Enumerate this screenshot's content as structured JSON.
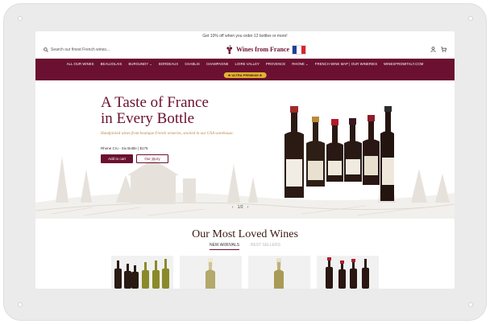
{
  "promo_bar": "Get 10% off when you order 12 bottles or more!",
  "header": {
    "search_placeholder": "Search our finest French wines...",
    "logo_text": "Wines from France"
  },
  "nav": {
    "items": [
      "ALL OUR WINES",
      "BEAUJOLAIS",
      "BURGUNDY ⌄",
      "BORDEAUX",
      "CHABLIS",
      "CHAMPAGNE",
      "LOIRE VALLEY",
      "PROVENCE",
      "RHONE ⌄",
      "FRENCH WINE MAP | OUR WINERIES",
      "WINESFROMITALY.COM"
    ],
    "badge": "★ ULTRA PREMIUM ★"
  },
  "hero": {
    "title_line1": "A Taste of France",
    "title_line2": "in Every Bottle",
    "subtitle": "Handpicked wines from boutique French wineries, stocked in our USA warehouse.",
    "note": "Rhone Cru - Six Bottle | $175",
    "primary_button": "Add to cart",
    "secondary_button": "Our Story",
    "slider_indicator": "1/2"
  },
  "section": {
    "title": "Our Most Loved Wines",
    "tabs": [
      "NEW ARRIVALS",
      "BEST SELLERS"
    ]
  },
  "colors": {
    "brand": "#6b1030",
    "badge": "#e1b233",
    "accent_text": "#b7864a"
  }
}
